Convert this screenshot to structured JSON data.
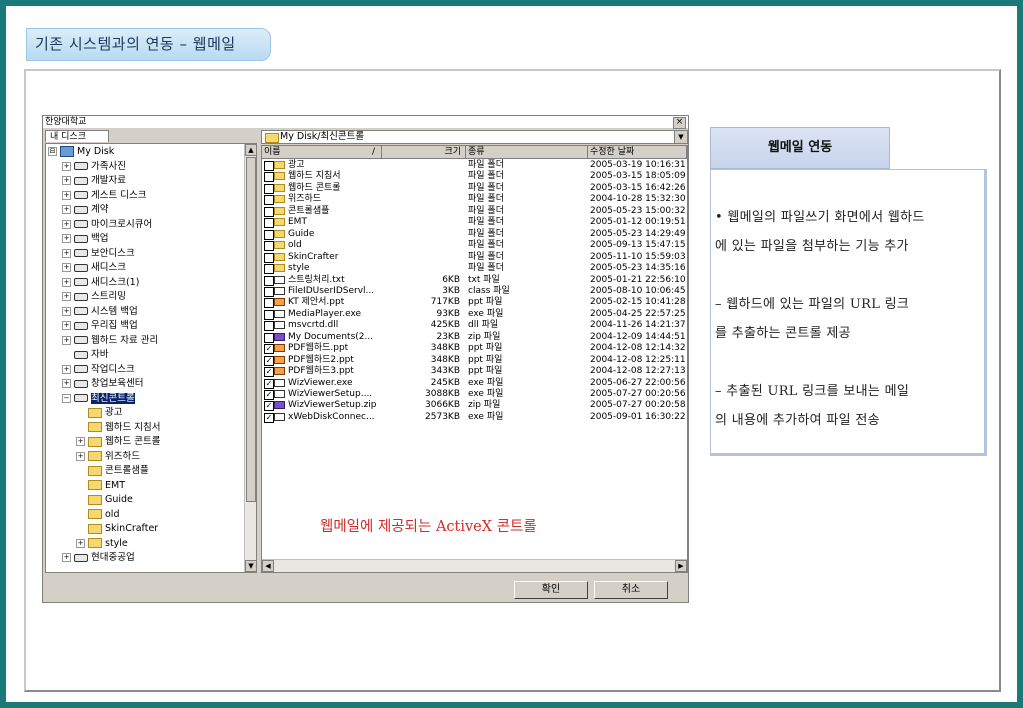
{
  "slide_title": "기존 시스템과의 연동 – 웹메일",
  "dialog": {
    "title": "한양대학교",
    "close_glyph": "×",
    "tab_label": "내 디스크",
    "tree": [
      {
        "label": "My Disk",
        "icon": "pc-icon",
        "exp": "⊟",
        "indent": 0
      },
      {
        "label": "가족사진",
        "icon": "drive-icon",
        "exp": "+",
        "indent": 1
      },
      {
        "label": "개발자료",
        "icon": "drive-icon",
        "exp": "+",
        "indent": 1
      },
      {
        "label": "게스트 디스크",
        "icon": "drive-icon",
        "exp": "+",
        "indent": 1
      },
      {
        "label": "계약",
        "icon": "drive-icon",
        "exp": "+",
        "indent": 1
      },
      {
        "label": "마이크로시큐어",
        "icon": "drive-icon",
        "exp": "+",
        "indent": 1
      },
      {
        "label": "백업",
        "icon": "drive-icon",
        "exp": "+",
        "indent": 1
      },
      {
        "label": "보안디스크",
        "icon": "drive-icon",
        "exp": "+",
        "indent": 1
      },
      {
        "label": "새디스크",
        "icon": "drive-icon",
        "exp": "+",
        "indent": 1
      },
      {
        "label": "새디스크(1)",
        "icon": "drive-icon",
        "exp": "+",
        "indent": 1
      },
      {
        "label": "스트리밍",
        "icon": "drive-icon",
        "exp": "+",
        "indent": 1
      },
      {
        "label": "시스템 백업",
        "icon": "drive-icon",
        "exp": "+",
        "indent": 1
      },
      {
        "label": "우리집 백업",
        "icon": "drive-icon",
        "exp": "+",
        "indent": 1
      },
      {
        "label": "웹하드 자료 관리",
        "icon": "drive-icon",
        "exp": "+",
        "indent": 1
      },
      {
        "label": "자바",
        "icon": "drive-icon",
        "exp": "",
        "indent": 1
      },
      {
        "label": "작업디스크",
        "icon": "drive-icon",
        "exp": "+",
        "indent": 1
      },
      {
        "label": "창업보육센터",
        "icon": "drive-icon",
        "exp": "+",
        "indent": 1
      },
      {
        "label": "최신콘트롤",
        "icon": "drive-icon",
        "exp": "−",
        "indent": 1,
        "selected": true
      },
      {
        "label": "광고",
        "icon": "folder-icon",
        "exp": "",
        "indent": 2
      },
      {
        "label": "웹하드 지침서",
        "icon": "folder-icon",
        "exp": "",
        "indent": 2
      },
      {
        "label": "웹하드 콘트롤",
        "icon": "folder-icon",
        "exp": "+",
        "indent": 2
      },
      {
        "label": "위즈하드",
        "icon": "folder-icon",
        "exp": "+",
        "indent": 2
      },
      {
        "label": "콘트롤샘플",
        "icon": "folder-icon",
        "exp": "",
        "indent": 2
      },
      {
        "label": "EMT",
        "icon": "folder-icon",
        "exp": "",
        "indent": 2
      },
      {
        "label": "Guide",
        "icon": "folder-icon",
        "exp": "",
        "indent": 2
      },
      {
        "label": "old",
        "icon": "folder-icon",
        "exp": "",
        "indent": 2
      },
      {
        "label": "SkinCrafter",
        "icon": "folder-icon",
        "exp": "",
        "indent": 2
      },
      {
        "label": "style",
        "icon": "folder-icon",
        "exp": "+",
        "indent": 2
      },
      {
        "label": "현대중공업",
        "icon": "drive-icon",
        "exp": "+",
        "indent": 1
      }
    ],
    "path": "My Disk/최신콘트롤",
    "columns": {
      "name": "이름",
      "sort": "/",
      "size": "크기",
      "type": "종류",
      "date": "수정한 날짜"
    },
    "files": [
      {
        "name": "광고",
        "size": "",
        "type": "파일 폴더",
        "date": "2005-03-19 10:16:31",
        "icon": "folder",
        "checked": false
      },
      {
        "name": "웹하드 지침서",
        "size": "",
        "type": "파일 폴더",
        "date": "2005-03-15 18:05:09",
        "icon": "folder",
        "checked": false
      },
      {
        "name": "웹하드 콘트롤",
        "size": "",
        "type": "파일 폴더",
        "date": "2005-03-15 16:42:26",
        "icon": "folder",
        "checked": false
      },
      {
        "name": "위즈하드",
        "size": "",
        "type": "파일 폴더",
        "date": "2004-10-28 15:32:30",
        "icon": "folder",
        "checked": false
      },
      {
        "name": "콘트롤샘플",
        "size": "",
        "type": "파일 폴더",
        "date": "2005-05-23 15:00:32",
        "icon": "folder",
        "checked": false
      },
      {
        "name": "EMT",
        "size": "",
        "type": "파일 폴더",
        "date": "2005-01-12 00:19:51",
        "icon": "folder",
        "checked": false
      },
      {
        "name": "Guide",
        "size": "",
        "type": "파일 폴더",
        "date": "2005-05-23 14:29:49",
        "icon": "folder",
        "checked": false
      },
      {
        "name": "old",
        "size": "",
        "type": "파일 폴더",
        "date": "2005-09-13 15:47:15",
        "icon": "folder",
        "checked": false
      },
      {
        "name": "SkinCrafter",
        "size": "",
        "type": "파일 폴더",
        "date": "2005-11-10 15:59:03",
        "icon": "folder",
        "checked": false
      },
      {
        "name": "style",
        "size": "",
        "type": "파일 폴더",
        "date": "2005-05-23 14:35:16",
        "icon": "folder",
        "checked": false
      },
      {
        "name": "스트링처리.txt",
        "size": "6KB",
        "type": "txt 파일",
        "date": "2005-01-21 22:56:10",
        "icon": "file",
        "checked": false
      },
      {
        "name": "FileIDUserIDServl...",
        "size": "3KB",
        "type": "class 파일",
        "date": "2005-08-10 10:06:45",
        "icon": "file",
        "checked": false
      },
      {
        "name": "KT 제안서.ppt",
        "size": "717KB",
        "type": "ppt 파일",
        "date": "2005-02-15 10:41:28",
        "icon": "ppt",
        "checked": false
      },
      {
        "name": "MediaPlayer.exe",
        "size": "93KB",
        "type": "exe 파일",
        "date": "2005-04-25 22:57:25",
        "icon": "file",
        "checked": false
      },
      {
        "name": "msvcrtd.dll",
        "size": "425KB",
        "type": "dll 파일",
        "date": "2004-11-26 14:21:37",
        "icon": "file",
        "checked": false
      },
      {
        "name": "My Documents(2...",
        "size": "23KB",
        "type": "zip 파일",
        "date": "2004-12-09 14:44:51",
        "icon": "zip",
        "checked": false
      },
      {
        "name": "PDF웹하드.ppt",
        "size": "348KB",
        "type": "ppt 파일",
        "date": "2004-12-08 12:14:32",
        "icon": "ppt",
        "checked": true
      },
      {
        "name": "PDF웹하드2.ppt",
        "size": "348KB",
        "type": "ppt 파일",
        "date": "2004-12-08 12:25:11",
        "icon": "ppt",
        "checked": true
      },
      {
        "name": "PDF웹하드3.ppt",
        "size": "343KB",
        "type": "ppt 파일",
        "date": "2004-12-08 12:27:13",
        "icon": "ppt",
        "checked": true
      },
      {
        "name": "WizViewer.exe",
        "size": "245KB",
        "type": "exe 파일",
        "date": "2005-06-27 22:00:56",
        "icon": "file",
        "checked": true
      },
      {
        "name": "WizViewerSetup....",
        "size": "3088KB",
        "type": "exe 파일",
        "date": "2005-07-27 00:20:56",
        "icon": "file",
        "checked": true
      },
      {
        "name": "WizViewerSetup.zip",
        "size": "3066KB",
        "type": "zip 파일",
        "date": "2005-07-27 00:20:58",
        "icon": "zip",
        "checked": true
      },
      {
        "name": "xWebDiskConnec...",
        "size": "2573KB",
        "type": "exe 파일",
        "date": "2005-09-01 16:30:22",
        "icon": "file",
        "checked": true
      }
    ],
    "caption": "웹메일에 제공되는 ActiveX 콘트롤",
    "ok_label": "확인",
    "cancel_label": "취소"
  },
  "panel": {
    "title": "웹메일 연동",
    "lines": [
      "• 웹메일의 파일쓰기 화면에서 웹하드",
      "에 있는 파일을 첨부하는 기능 추가",
      "",
      " – 웹하드에 있는 파일의 URL 링크",
      "를 추출하는 콘트롤 제공",
      "",
      " – 추출된 URL 링크를 보내는 메일",
      "의 내용에 추가하여 파일 전송"
    ]
  }
}
